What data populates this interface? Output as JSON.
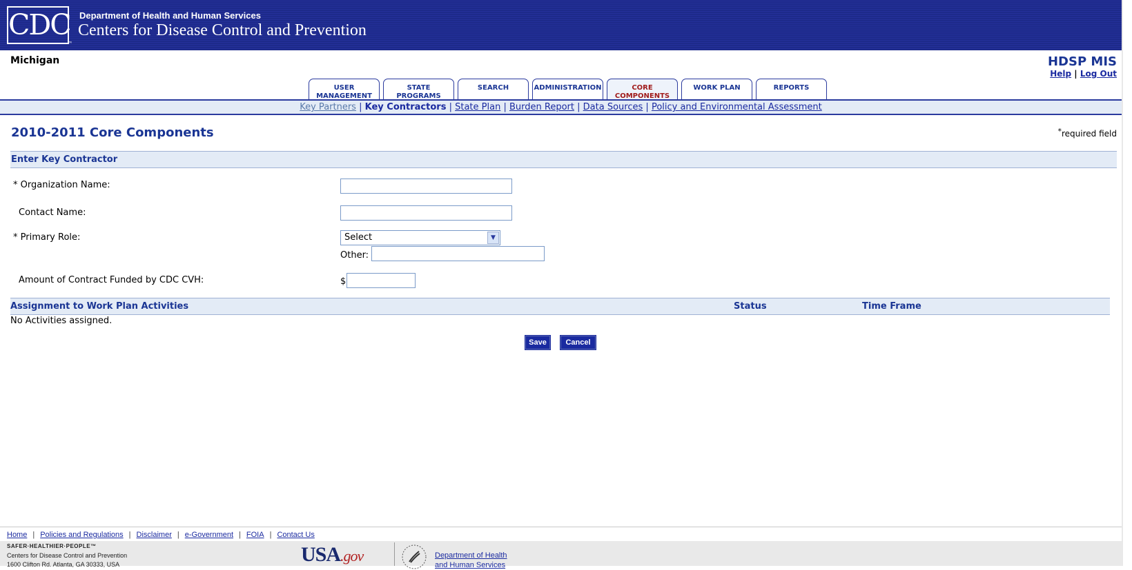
{
  "header": {
    "logo_text": "CDC",
    "dept": "Department of Health and Human Services",
    "agency": "Centers for Disease Control and Prevention"
  },
  "top": {
    "state": "Michigan",
    "app_title": "HDSP MIS",
    "help_label": "Help",
    "logout_label": "Log Out",
    "util_sep": "|"
  },
  "tabs": [
    {
      "label_line1": "USER",
      "label_line2": "MANAGEMENT"
    },
    {
      "label_line1": "STATE",
      "label_line2": "PROGRAMS"
    },
    {
      "label_line1": "SEARCH",
      "label_line2": ""
    },
    {
      "label_line1": "ADMINISTRATION",
      "label_line2": ""
    },
    {
      "label_line1": "CORE",
      "label_line2": "COMPONENTS",
      "active": true
    },
    {
      "label_line1": "WORK PLAN",
      "label_line2": ""
    },
    {
      "label_line1": "REPORTS",
      "label_line2": ""
    }
  ],
  "subnav": {
    "items": [
      "Key Partners",
      "Key Contractors",
      "State Plan",
      "Burden Report",
      "Data Sources",
      "Policy and Environmental Assessment"
    ],
    "current": "Key Contractors",
    "sep": "|"
  },
  "page": {
    "title": "2010-2011 Core Components",
    "required_star": "*",
    "required_note": "required field",
    "section_title": "Enter Key Contractor"
  },
  "form": {
    "org_label": "* Organization Name:",
    "org_value": "",
    "contact_label": "Contact Name:",
    "contact_value": "",
    "role_label": "* Primary Role:",
    "role_selected": "Select",
    "other_label": "Other:",
    "other_value": "",
    "amount_label": "Amount of Contract Funded by CDC CVH:",
    "amount_prefix": "$",
    "amount_value": ""
  },
  "activities": {
    "header_name": "Assignment to Work Plan Activities",
    "header_status": "Status",
    "header_timeframe": "Time Frame",
    "empty_text": "No Activities assigned."
  },
  "buttons": {
    "save": "Save",
    "cancel": "Cancel"
  },
  "footer": {
    "links": [
      "Home",
      "Policies and Regulations",
      "Disclaimer",
      "e-Government",
      "FOIA",
      "Contact Us"
    ],
    "sep": "|",
    "tagline": "SAFER·HEALTHIER·PEOPLE™",
    "addr_line1": "Centers for Disease Control and Prevention",
    "addr_line2": "1600 Clifton Rd. Atlanta, GA 30333, USA",
    "usa_text": "USA",
    "usa_gov": ".gov",
    "hhs_line1": "Department of Health",
    "hhs_line2": "and Human Services"
  },
  "colors": {
    "banner": "#1d2a8a",
    "brand_blue": "#1a3594",
    "link": "#1a2aa0",
    "active_tab": "#a01b1b",
    "section_bg": "#e3ebf6"
  }
}
